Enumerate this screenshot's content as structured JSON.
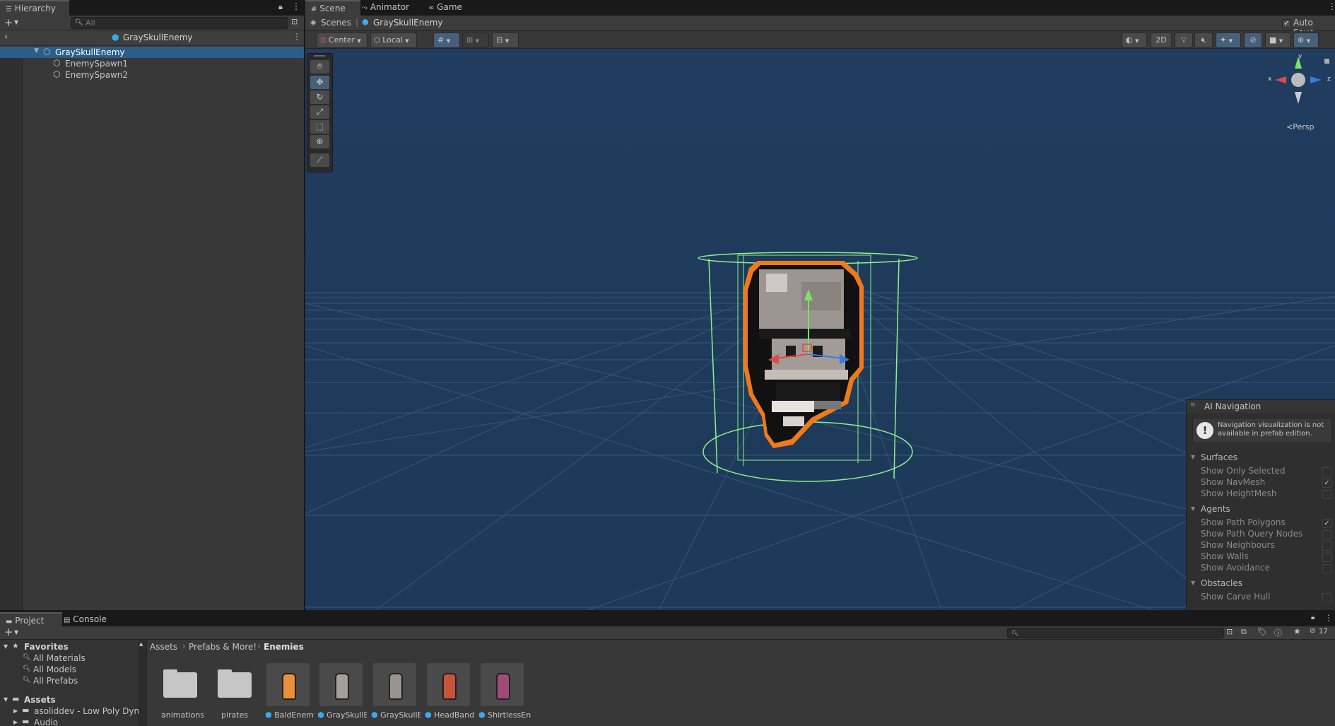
{
  "hierarchy": {
    "tab_label": "Hierarchy",
    "search_placeholder": "All",
    "prefab_title": "GraySkullEnemy",
    "items": [
      {
        "label": "GraySkullEnemy",
        "selected": true
      },
      {
        "label": "EnemySpawn1"
      },
      {
        "label": "EnemySpawn2"
      }
    ]
  },
  "scene_tabs": [
    {
      "label": "Scene"
    },
    {
      "label": "Animator"
    },
    {
      "label": "Game"
    }
  ],
  "breadcrumb": {
    "scenes": "Scenes",
    "prefab": "GraySkullEnemy",
    "auto_save": "Auto Save"
  },
  "scene_toolbar": {
    "pivot": "Center",
    "space": "Local",
    "mode_2d": "2D"
  },
  "gizmo": {
    "x": "x",
    "y": "y",
    "z": "z",
    "projection": "Persp"
  },
  "ai_navigation": {
    "title": "AI Navigation",
    "warning": "Navigation visualization is not available in prefab edition.",
    "surfaces_header": "Surfaces",
    "surfaces": [
      {
        "label": "Show Only Selected",
        "checked": false
      },
      {
        "label": "Show NavMesh",
        "checked": true
      },
      {
        "label": "Show HeightMesh",
        "checked": false
      }
    ],
    "agents_header": "Agents",
    "agents": [
      {
        "label": "Show Path Polygons",
        "checked": true
      },
      {
        "label": "Show Path Query Nodes",
        "checked": false
      },
      {
        "label": "Show Neighbours",
        "checked": false
      },
      {
        "label": "Show Walls",
        "checked": false
      },
      {
        "label": "Show Avoidance",
        "checked": false
      }
    ],
    "obstacles_header": "Obstacles",
    "obstacles": [
      {
        "label": "Show Carve Hull",
        "checked": false
      }
    ]
  },
  "bottom_tabs": [
    {
      "label": "Project"
    },
    {
      "label": "Console"
    }
  ],
  "project": {
    "visible_count": "17",
    "favorites_header": "Favorites",
    "favorites": [
      "All Materials",
      "All Models",
      "All Prefabs"
    ],
    "assets_header": "Assets",
    "asset_folders": [
      "asoliddev - Low Poly Dyn",
      "Audio"
    ],
    "path": [
      "Assets",
      "Prefabs & More!",
      "Enemies"
    ],
    "items": [
      {
        "label": "animations",
        "kind": "folder"
      },
      {
        "label": "pirates",
        "kind": "folder"
      },
      {
        "label": "BaldEnemy",
        "kind": "prefab"
      },
      {
        "label": "GraySkullE...",
        "kind": "prefab"
      },
      {
        "label": "GraySkullE...",
        "kind": "prefab"
      },
      {
        "label": "HeadBand...",
        "kind": "prefab"
      },
      {
        "label": "ShirtlessEn...",
        "kind": "prefab"
      }
    ]
  },
  "colors": {
    "scene_bg": "#1f3b5c",
    "selection": "#2c5d87",
    "panel": "#383838",
    "collider": "#8ef08e",
    "outline": "#f07a1a"
  }
}
